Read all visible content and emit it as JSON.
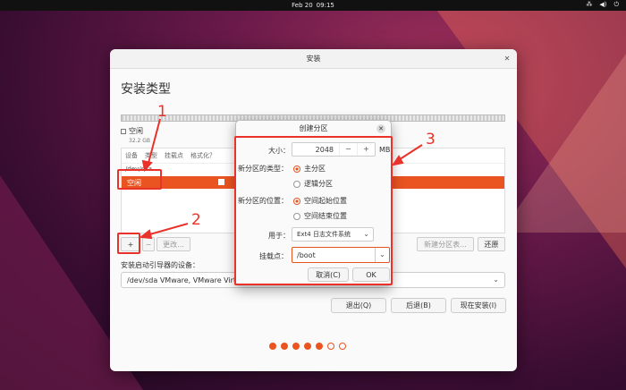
{
  "topbar": {
    "date": "Feb 20",
    "time": "09:15"
  },
  "window": {
    "title": "安装",
    "page_title": "安装类型",
    "legend": {
      "label": "空闲",
      "size": "32.2 GB"
    },
    "table": {
      "headers": [
        "设备",
        "类型",
        "挂载点",
        "格式化？"
      ],
      "device": "/dev/sda",
      "row_label": "空闲"
    },
    "toolbar": {
      "add": "+",
      "minus": "−",
      "change": "更改...",
      "new_table": "新建分区表...",
      "revert": "还原"
    },
    "boot_label": "安装启动引导器的设备：",
    "boot_value": "/dev/sda VMware, VMware Virtu",
    "buttons": {
      "quit": "退出(Q)",
      "back": "后退(B)",
      "install": "现在安装(I)"
    },
    "progress": {
      "total": 7,
      "done": 5
    }
  },
  "dialog": {
    "title": "创建分区",
    "size_label": "大小：",
    "size_value": "2048",
    "size_unit": "MB",
    "minus": "−",
    "plus": "+",
    "type_label": "新分区的类型：",
    "type_primary": "主分区",
    "type_logical": "逻辑分区",
    "location_label": "新分区的位置：",
    "loc_start": "空间起始位置",
    "loc_end": "空间结束位置",
    "use_label": "用于：",
    "use_value": "Ext4 日志文件系统",
    "mount_label": "挂载点：",
    "mount_value": "/boot",
    "cancel": "取消(C)",
    "ok": "OK"
  },
  "annotations": [
    "1",
    "2",
    "3"
  ],
  "colors": {
    "accent": "#e95420",
    "annotation": "#e8322a"
  }
}
